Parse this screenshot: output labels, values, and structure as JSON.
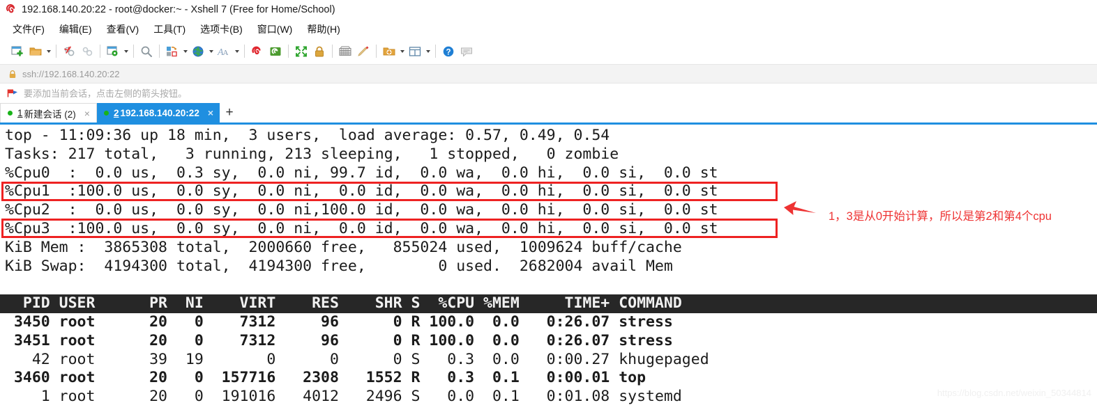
{
  "window": {
    "title": "192.168.140.20:22 - root@docker:~ - Xshell 7 (Free for Home/School)",
    "logo_icon": "xshell-logo-icon"
  },
  "menubar": {
    "items": [
      {
        "label": "文件(F)",
        "accel": "F",
        "name": "menu-file"
      },
      {
        "label": "编辑(E)",
        "accel": "E",
        "name": "menu-edit"
      },
      {
        "label": "查看(V)",
        "accel": "V",
        "name": "menu-view"
      },
      {
        "label": "工具(T)",
        "accel": "T",
        "name": "menu-tools"
      },
      {
        "label": "选项卡(B)",
        "accel": "B",
        "name": "menu-tab"
      },
      {
        "label": "窗口(W)",
        "accel": "W",
        "name": "menu-window"
      },
      {
        "label": "帮助(H)",
        "accel": "H",
        "name": "menu-help"
      }
    ]
  },
  "toolbar": {
    "items": [
      {
        "icon": "new-session-icon",
        "caret": false
      },
      {
        "icon": "open-folder-icon",
        "caret": true
      },
      {
        "sep": true
      },
      {
        "icon": "disconnect-icon",
        "caret": false
      },
      {
        "icon": "reconnect-icon",
        "caret": false
      },
      {
        "sep": true
      },
      {
        "icon": "session-properties-icon",
        "caret": true
      },
      {
        "sep": true
      },
      {
        "icon": "find-icon",
        "caret": false
      },
      {
        "sep": true
      },
      {
        "icon": "copy-paste-icon",
        "caret": true
      },
      {
        "icon": "globe-icon",
        "caret": true
      },
      {
        "icon": "font-icon",
        "caret": true
      },
      {
        "sep": true
      },
      {
        "icon": "xftp-icon",
        "caret": false
      },
      {
        "icon": "xagent-icon",
        "caret": false
      },
      {
        "sep": true
      },
      {
        "icon": "fullscreen-icon",
        "caret": false
      },
      {
        "icon": "lock-icon",
        "caret": false
      },
      {
        "sep": true
      },
      {
        "icon": "keyboard-icon",
        "caret": false
      },
      {
        "icon": "highlight-pen-icon",
        "caret": false
      },
      {
        "sep": true
      },
      {
        "icon": "add-folder-icon",
        "caret": true
      },
      {
        "icon": "layout-icon",
        "caret": true
      },
      {
        "sep": true
      },
      {
        "icon": "help-icon",
        "caret": false
      },
      {
        "icon": "chat-icon",
        "caret": false
      }
    ]
  },
  "address_bar": {
    "lock_icon": "lock-icon",
    "value": "ssh://192.168.140.20:22"
  },
  "hint_bar": {
    "flag_icon": "bookmark-flag-icon",
    "text": "要添加当前会话，点击左侧的箭头按钮。"
  },
  "tabs": {
    "items": [
      {
        "number": "1",
        "label": "新建会话 (2)",
        "active": false,
        "close_icon": "close-icon"
      },
      {
        "number": "2",
        "label": "192.168.140.20:22",
        "active": true,
        "close_icon": "close-icon"
      }
    ],
    "new_tab_label": "+"
  },
  "terminal": {
    "header_lines": [
      "top - 11:09:36 up 18 min,  3 users,  load average: 0.57, 0.49, 0.54",
      "Tasks: 217 total,   3 running, 213 sleeping,   1 stopped,   0 zombie",
      "%Cpu0  :  0.0 us,  0.3 sy,  0.0 ni, 99.7 id,  0.0 wa,  0.0 hi,  0.0 si,  0.0 st",
      "%Cpu1  :100.0 us,  0.0 sy,  0.0 ni,  0.0 id,  0.0 wa,  0.0 hi,  0.0 si,  0.0 st",
      "%Cpu2  :  0.0 us,  0.0 sy,  0.0 ni,100.0 id,  0.0 wa,  0.0 hi,  0.0 si,  0.0 st",
      "%Cpu3  :100.0 us,  0.0 sy,  0.0 ni,  0.0 id,  0.0 wa,  0.0 hi,  0.0 si,  0.0 st",
      "KiB Mem :  3865308 total,  2000660 free,   855024 used,  1009624 buff/cache",
      "KiB Swap:  4194300 total,  4194300 free,        0 used.  2682004 avail Mem"
    ],
    "top_line": {
      "command": "top",
      "time": "11:09:36",
      "uptime": "18 min",
      "users": "3",
      "load_average": [
        "0.57",
        "0.49",
        "0.54"
      ]
    },
    "tasks_line": {
      "total": "217",
      "running": "3",
      "sleeping": "213",
      "stopped": "1",
      "zombie": "0"
    },
    "cpus": [
      {
        "name": "%Cpu0",
        "sepcol": "  :",
        "us": "  0.0",
        "sy": "  0.3",
        "ni": "  0.0",
        "id": " 99.7",
        "wa": "  0.0",
        "hi": "  0.0",
        "si": "  0.0",
        "st": "  0.0",
        "highlighted": false
      },
      {
        "name": "%Cpu1",
        "sepcol": "  :",
        "us": "100.0",
        "sy": "  0.0",
        "ni": "  0.0",
        "id": "  0.0",
        "wa": "  0.0",
        "hi": "  0.0",
        "si": "  0.0",
        "st": "  0.0",
        "highlighted": true
      },
      {
        "name": "%Cpu2",
        "sepcol": "  :",
        "us": "  0.0",
        "sy": "  0.0",
        "ni": "  0.0",
        "id": "100.0",
        "wa": "  0.0",
        "hi": "  0.0",
        "si": "  0.0",
        "st": "  0.0",
        "highlighted": false
      },
      {
        "name": "%Cpu3",
        "sepcol": "  :",
        "us": "100.0",
        "sy": "  0.0",
        "ni": "  0.0",
        "id": "  0.0",
        "wa": "  0.0",
        "hi": "  0.0",
        "si": "  0.0",
        "st": "  0.0",
        "highlighted": true
      }
    ],
    "mem_line": {
      "label": "KiB Mem :",
      "total": "3865308",
      "free": "2000660",
      "used": "855024",
      "buff_cache": "1009624"
    },
    "swap_line": {
      "label": "KiB Swap:",
      "total": "4194300",
      "free": "4194300",
      "used": "0",
      "avail": "2682004"
    },
    "table": {
      "header": "  PID USER      PR  NI    VIRT    RES    SHR S  %CPU %MEM     TIME+ COMMAND",
      "columns": [
        "PID",
        "USER",
        "PR",
        "NI",
        "VIRT",
        "RES",
        "SHR",
        "S",
        "%CPU",
        "%MEM",
        "TIME+",
        "COMMAND"
      ],
      "rows": [
        {
          "line": " 3450 root      20   0    7312     96      0 R 100.0  0.0   0:26.07 stress",
          "bold": true
        },
        {
          "line": " 3451 root      20   0    7312     96      0 R 100.0  0.0   0:26.07 stress",
          "bold": true
        },
        {
          "line": "   42 root      39  19       0      0      0 S   0.3  0.0   0:00.27 khugepaged",
          "bold": false
        },
        {
          "line": " 3460 root      20   0  157716   2308   1552 R   0.3  0.1   0:00.01 top",
          "bold": true
        },
        {
          "line": "    1 root      20   0  191016   4012   2496 S   0.0  0.1   0:01.08 systemd",
          "bold": false
        }
      ]
    }
  },
  "annotation": {
    "text": "1，3是从0开始计算，所以是第2和第4个cpu",
    "color": "#ee3333",
    "arrow_icon": "arrow-left-icon",
    "box_color": "#ee2222"
  },
  "watermark": {
    "text": "https://blog.csdn.net/weixin_50344814"
  }
}
